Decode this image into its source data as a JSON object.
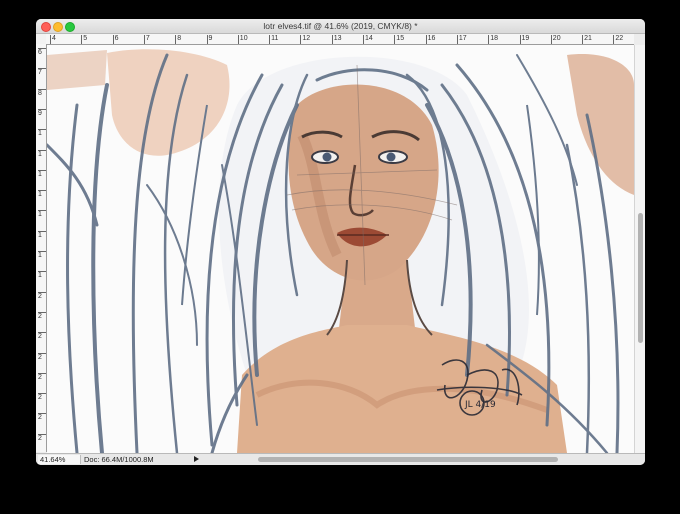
{
  "window": {
    "title": "lotr elves4.tif @ 41.6% (2019, CMYK/8) *"
  },
  "ruler_top": [
    "4",
    "5",
    "6",
    "7",
    "8",
    "9",
    "10",
    "11",
    "12",
    "13",
    "14",
    "15",
    "16",
    "17",
    "18",
    "19",
    "20",
    "21",
    "22",
    "23"
  ],
  "ruler_left": [
    "6",
    "7",
    "8",
    "9",
    "1",
    "1",
    "1",
    "1",
    "1",
    "1",
    "1",
    "1",
    "2",
    "2",
    "2",
    "2",
    "2",
    "2",
    "2",
    "2"
  ],
  "status": {
    "zoom": "41.64%",
    "doc": "Doc: 66.4M/1000.8M"
  },
  "artwork": {
    "signature": "JL 4/19"
  },
  "colors": {
    "skin": "#d9a98a",
    "skin_shadow": "#b77f62",
    "hair_line": "#5f6f86",
    "lips": "#9c4a34"
  }
}
